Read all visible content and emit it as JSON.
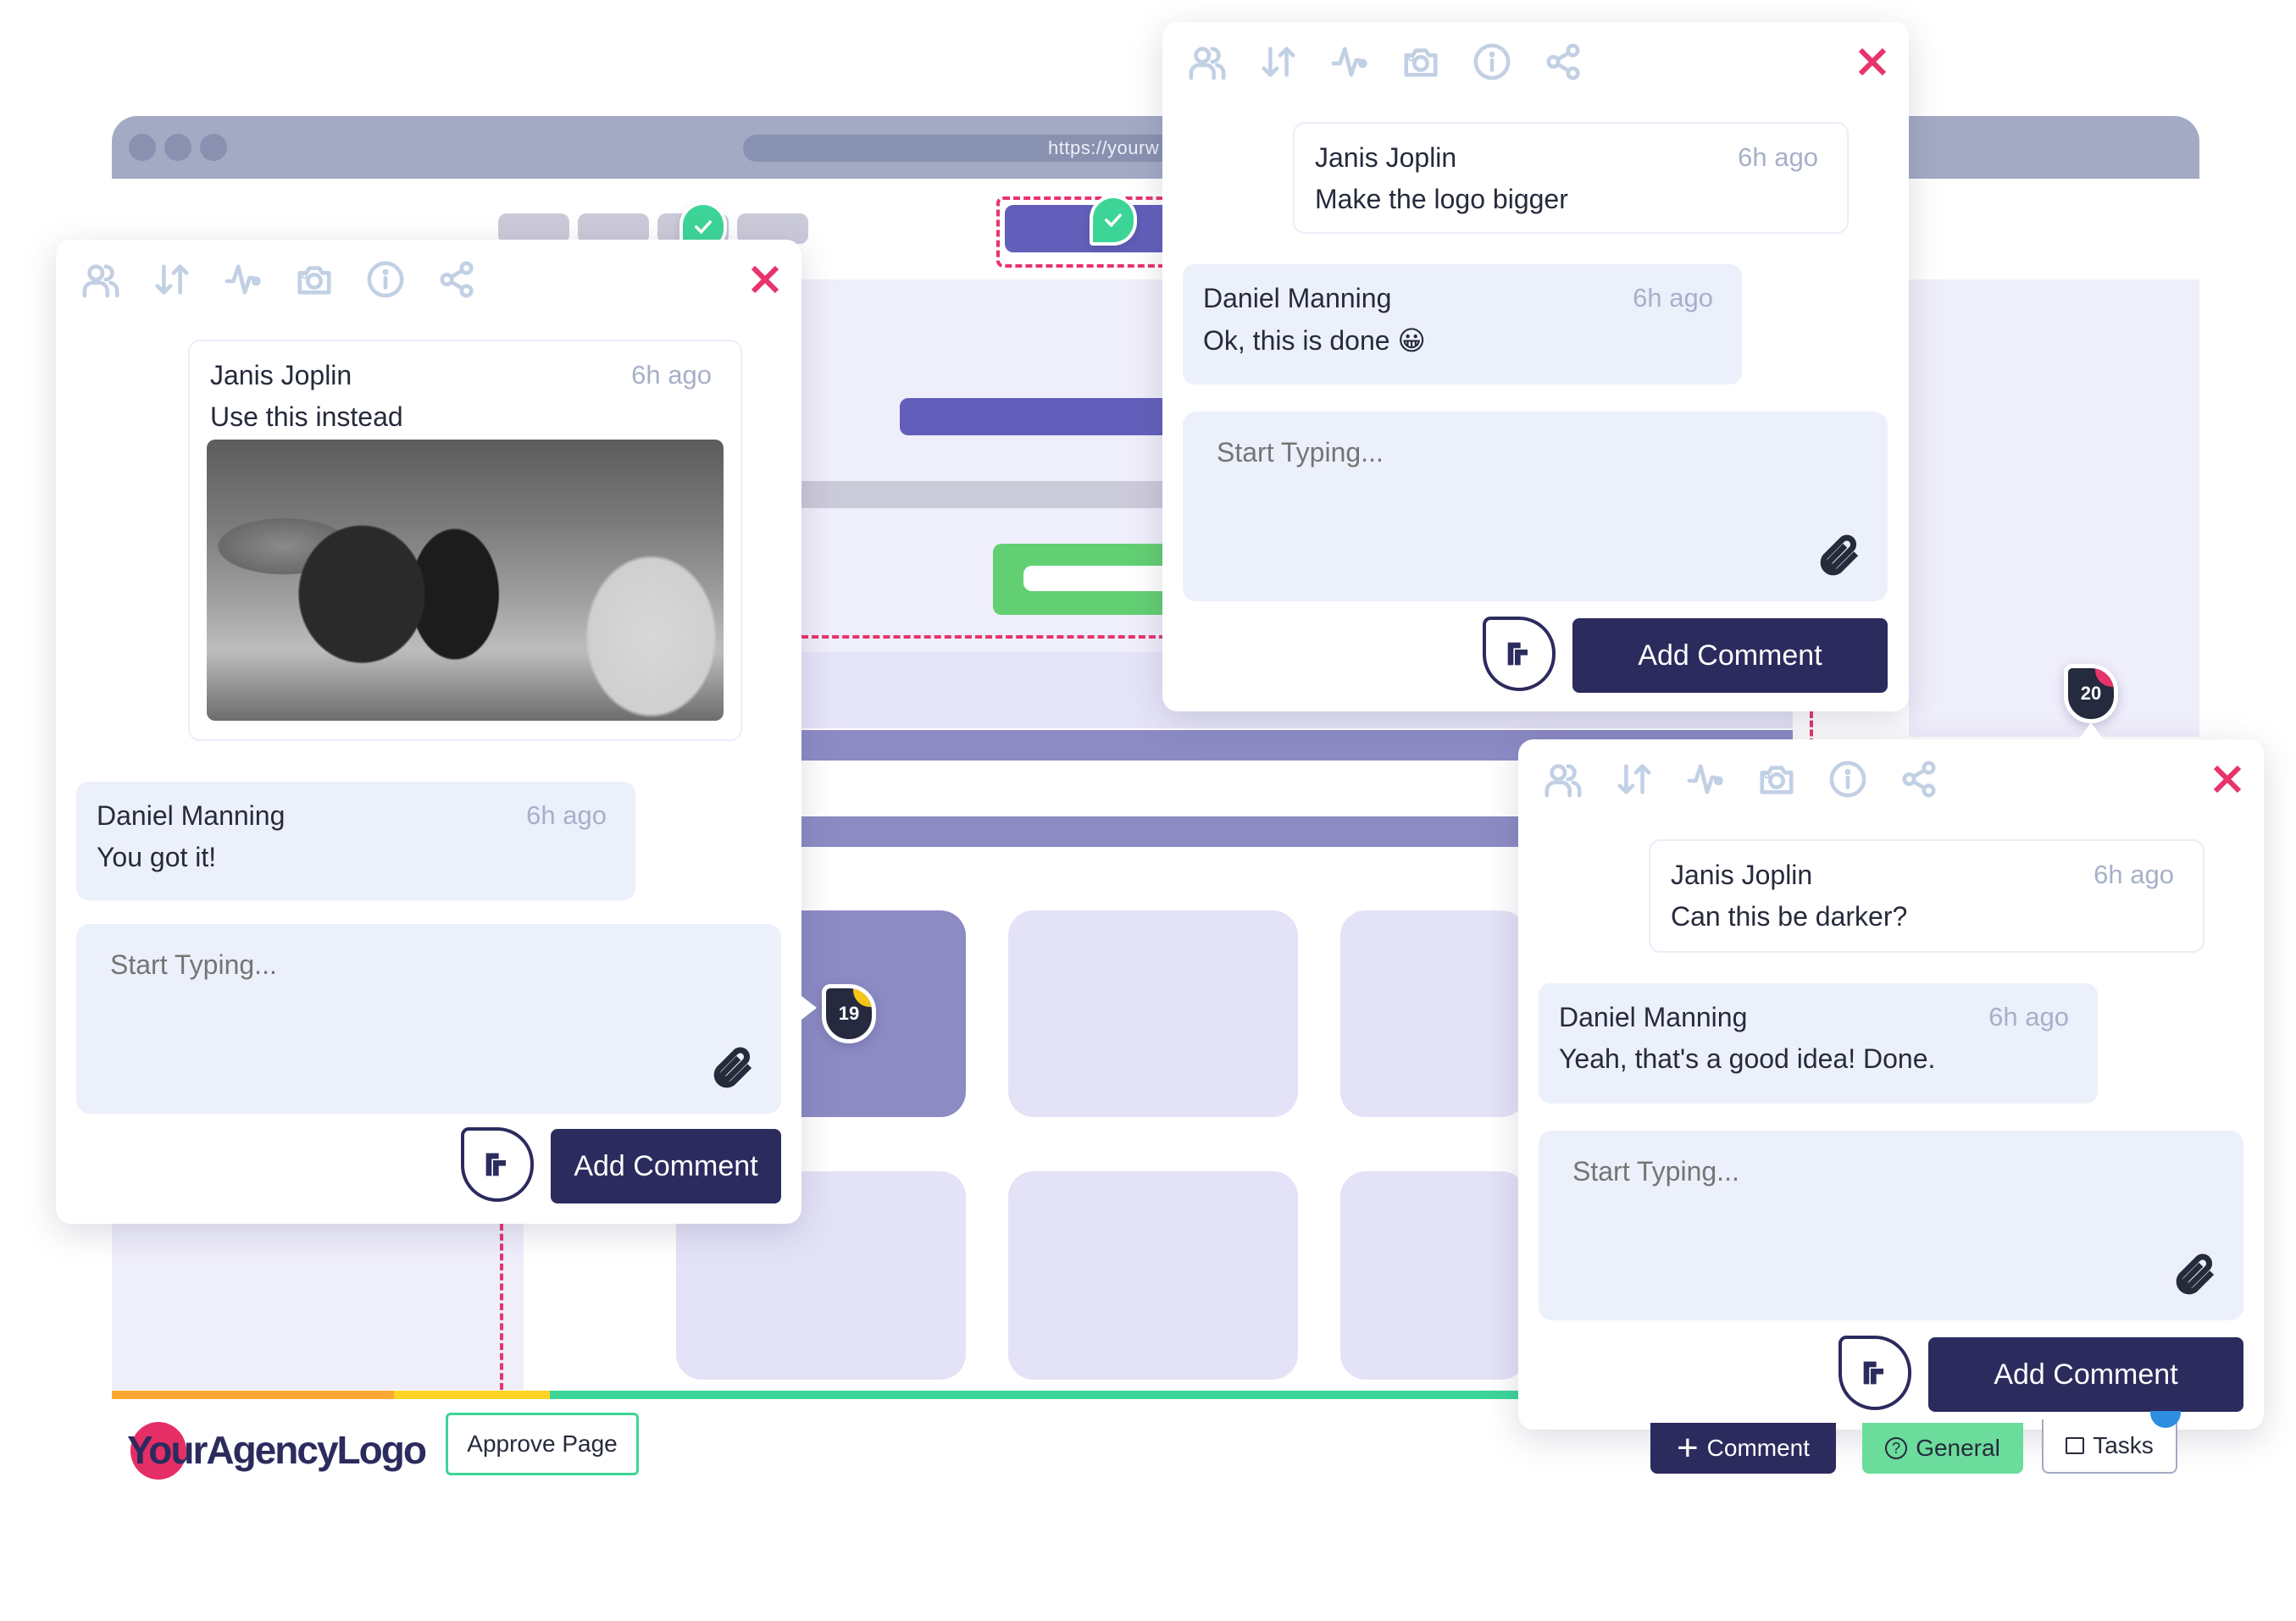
{
  "browser": {
    "url": "https://yourw"
  },
  "pins": {
    "approved_1": "check-pin",
    "approved_2": "check-pin",
    "badge_19": {
      "count": "19",
      "status_color": "#f5c518"
    },
    "badge_20": {
      "count": "20",
      "status_color": "#e8336b"
    }
  },
  "toolbar_icons": [
    "users-icon",
    "sort-icon",
    "activity-icon",
    "camera-icon",
    "info-icon",
    "share-icon"
  ],
  "popups": [
    {
      "messages": [
        {
          "author": "Janis Joplin",
          "time": "6h ago",
          "text": "Use this instead",
          "attachment": "concert-photo"
        },
        {
          "author": "Daniel Manning",
          "time": "6h ago",
          "text": "You got it!"
        }
      ],
      "input_placeholder": "Start Typing...",
      "add_button": "Add Comment"
    },
    {
      "messages": [
        {
          "author": "Janis Joplin",
          "time": "6h ago",
          "text": "Make the logo bigger"
        },
        {
          "author": "Daniel Manning",
          "time": "6h ago",
          "text": "Ok, this is done 😀"
        }
      ],
      "input_placeholder": "Start Typing...",
      "add_button": "Add Comment"
    },
    {
      "messages": [
        {
          "author": "Janis Joplin",
          "time": "6h ago",
          "text": "Can this be darker?"
        },
        {
          "author": "Daniel Manning",
          "time": "6h ago",
          "text": "Yeah, that's a good idea! Done."
        }
      ],
      "input_placeholder": "Start Typing...",
      "add_button": "Add Comment"
    }
  ],
  "footer": {
    "logo": "YourAgencyLogo",
    "approve_page": "Approve Page",
    "comment_button": "Comment",
    "general_button": "General",
    "tasks_button": "Tasks"
  },
  "progress_segments": [
    {
      "color": "#fea733",
      "fraction": 0.135
    },
    {
      "color": "#fdd425",
      "fraction": 0.075
    },
    {
      "color": "#3dd597",
      "fraction": 0.79
    }
  ],
  "colors": {
    "primary": "#2c2b5e",
    "accent_red": "#e8336b",
    "success": "#3dd597",
    "general_bg": "#6bdc9c"
  }
}
